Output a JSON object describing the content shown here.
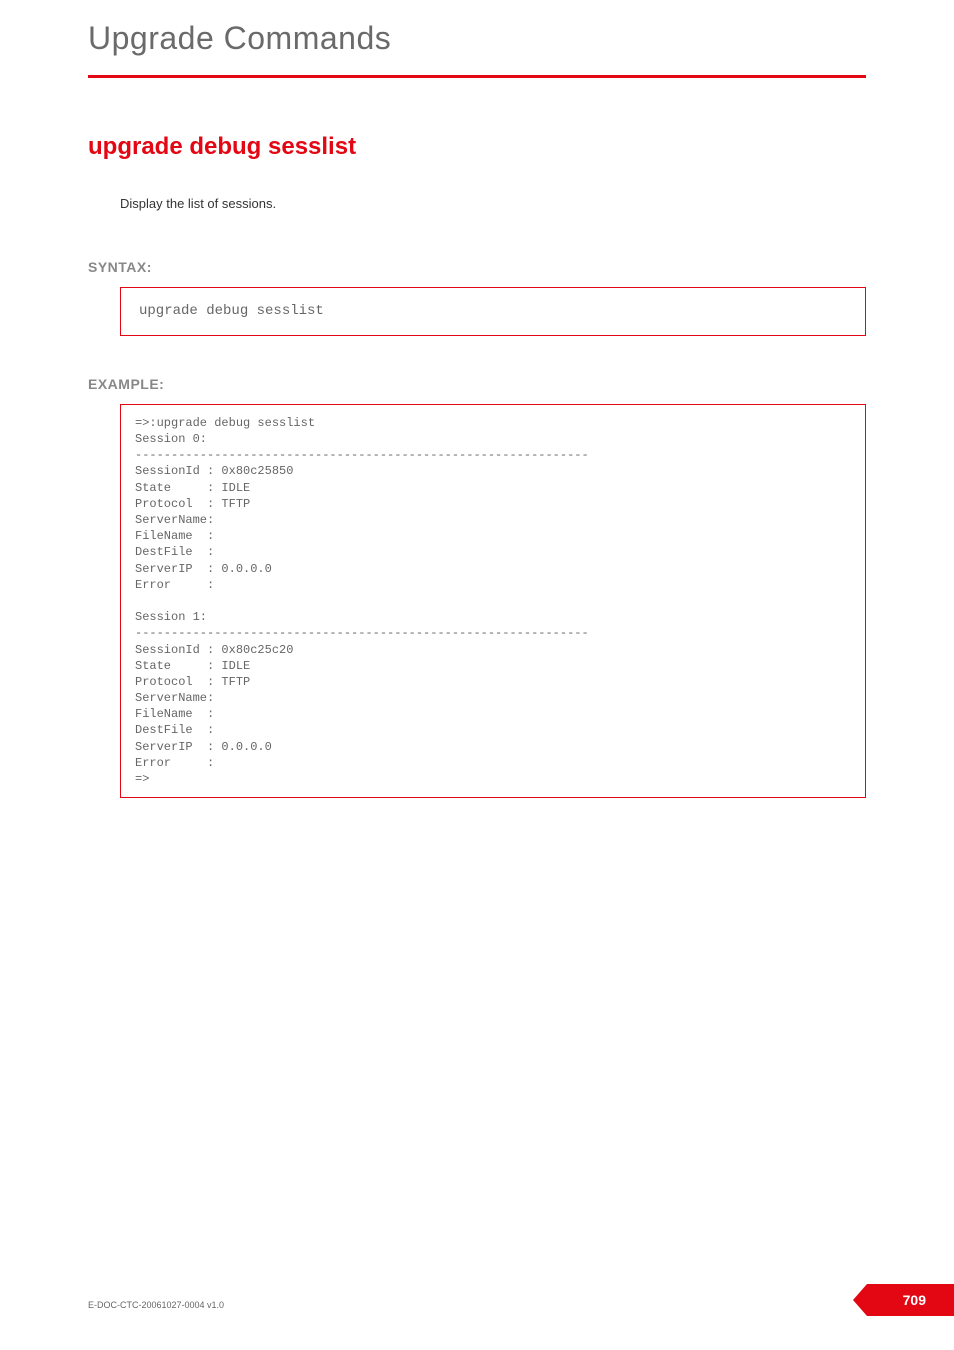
{
  "chapter_title": "Upgrade Commands",
  "section_title": "upgrade debug sesslist",
  "description": "Display the list of sessions.",
  "syntax": {
    "heading": "SYNTAX:",
    "code": "upgrade debug sesslist"
  },
  "example": {
    "heading": "EXAMPLE:",
    "code": "=>:upgrade debug sesslist\nSession 0:\n---------------------------------------------------------------\nSessionId : 0x80c25850\nState     : IDLE\nProtocol  : TFTP\nServerName:\nFileName  :\nDestFile  :\nServerIP  : 0.0.0.0\nError     :\n\nSession 1:\n---------------------------------------------------------------\nSessionId : 0x80c25c20\nState     : IDLE\nProtocol  : TFTP\nServerName:\nFileName  :\nDestFile  :\nServerIP  : 0.0.0.0\nError     :\n=>"
  },
  "footer": {
    "doc_id": "E-DOC-CTC-20061027-0004 v1.0",
    "page_number": "709"
  }
}
